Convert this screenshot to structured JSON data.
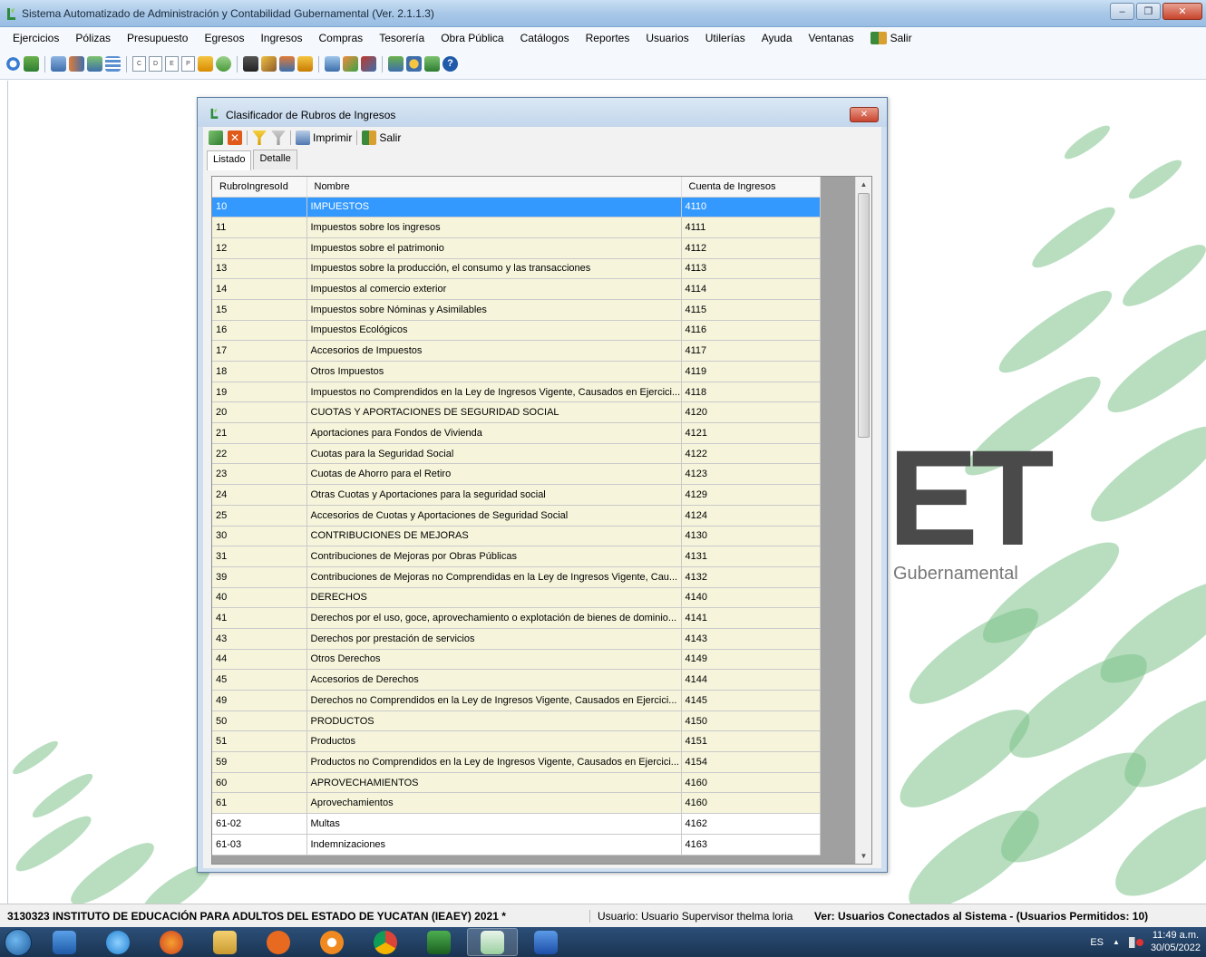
{
  "window": {
    "title": "Sistema Automatizado de Administración y Contabilidad Gubernamental  (Ver. 2.1.1.3)",
    "minimize_glyph": "‒",
    "restore_glyph": "❐",
    "close_glyph": "✕"
  },
  "menu": [
    "Ejercicios",
    "Pólizas",
    "Presupuesto",
    "Egresos",
    "Ingresos",
    "Compras",
    "Tesorería",
    "Obra Pública",
    "Catálogos",
    "Reportes",
    "Usuarios",
    "Utilerías",
    "Ayuda",
    "Ventanas",
    "Salir"
  ],
  "toolbar_icons": [
    "refresh-icon",
    "report-icon",
    "print-icon",
    "transfer-icon",
    "ledger-icon",
    "grid-icon",
    "doc-c-icon",
    "doc-d-icon",
    "doc-e-icon",
    "doc-p-icon",
    "budget-icon",
    "money-icon",
    "archive-icon",
    "edit-icon",
    "users-icon",
    "box-icon",
    "calc-icon",
    "tools-icon",
    "settings-icon",
    "tree-icon",
    "security-icon",
    "save-icon",
    "help-icon"
  ],
  "toolbar_doc_letters": [
    "C",
    "D",
    "E",
    "P"
  ],
  "background_logo": {
    "letters": "ET",
    "subtitle": "Gubernamental"
  },
  "dialog": {
    "title": "Clasificador de Rubros de Ingresos",
    "close_glyph": "✕",
    "tools": {
      "print_label": "Imprimir",
      "exit_label": "Salir"
    },
    "tabs": [
      "Listado",
      "Detalle"
    ],
    "columns": [
      "RubroIngresoId",
      "Nombre",
      "Cuenta de Ingresos"
    ],
    "rows": [
      [
        "10",
        "IMPUESTOS",
        "4110"
      ],
      [
        "11",
        "Impuestos sobre los ingresos",
        "4111"
      ],
      [
        "12",
        "Impuestos sobre el patrimonio",
        "4112"
      ],
      [
        "13",
        "Impuestos sobre la producción, el consumo y las transacciones",
        "4113"
      ],
      [
        "14",
        "Impuestos al comercio exterior",
        "4114"
      ],
      [
        "15",
        "Impuestos sobre Nóminas y Asimilables",
        "4115"
      ],
      [
        "16",
        "Impuestos Ecológicos",
        "4116"
      ],
      [
        "17",
        "Accesorios de Impuestos",
        "4117"
      ],
      [
        "18",
        "Otros Impuestos",
        "4119"
      ],
      [
        "19",
        "Impuestos no Comprendidos en la Ley de Ingresos Vigente, Causados en Ejercici...",
        "4118"
      ],
      [
        "20",
        "CUOTAS Y APORTACIONES DE SEGURIDAD SOCIAL",
        "4120"
      ],
      [
        "21",
        "Aportaciones para Fondos de Vivienda",
        "4121"
      ],
      [
        "22",
        "Cuotas para la Seguridad Social",
        "4122"
      ],
      [
        "23",
        "Cuotas de Ahorro para el Retiro",
        "4123"
      ],
      [
        "24",
        "Otras Cuotas y Aportaciones para la seguridad social",
        "4129"
      ],
      [
        "25",
        "Accesorios de Cuotas y Aportaciones de Seguridad Social",
        "4124"
      ],
      [
        "30",
        "CONTRIBUCIONES DE MEJORAS",
        "4130"
      ],
      [
        "31",
        "Contribuciones de Mejoras por Obras Públicas",
        "4131"
      ],
      [
        "39",
        "Contribuciones de Mejoras no Comprendidas en la Ley de Ingresos Vigente, Cau...",
        "4132"
      ],
      [
        "40",
        "DERECHOS",
        "4140"
      ],
      [
        "41",
        "Derechos por el uso, goce, aprovechamiento o explotación de bienes de dominio...",
        "4141"
      ],
      [
        "43",
        "Derechos por prestación de servicios",
        "4143"
      ],
      [
        "44",
        "Otros Derechos",
        "4149"
      ],
      [
        "45",
        "Accesorios de Derechos",
        "4144"
      ],
      [
        "49",
        "Derechos no Comprendidos en la Ley de Ingresos Vigente, Causados en Ejercici...",
        "4145"
      ],
      [
        "50",
        "PRODUCTOS",
        "4150"
      ],
      [
        "51",
        "Productos",
        "4151"
      ],
      [
        "59",
        "Productos no Comprendidos en la Ley de Ingresos Vigente, Causados en Ejercici...",
        "4154"
      ],
      [
        "60",
        "APROVECHAMIENTOS",
        "4160"
      ],
      [
        "61",
        "Aprovechamientos",
        "4160"
      ],
      [
        "61-02",
        "Multas",
        "4162"
      ],
      [
        "61-03",
        "Indemnizaciones",
        "4163"
      ]
    ],
    "selected_row": 0,
    "white_rows_from": 30
  },
  "status": {
    "entity": "3130323 INSTITUTO DE EDUCACIÓN PARA ADULTOS DEL ESTADO DE YUCATAN (IEAEY)  2021  *",
    "user": "Usuario: Usuario Supervisor thelma loria",
    "connected": "Ver: Usuarios Conectados al Sistema - (Usuarios Permitidos: 10)"
  },
  "taskbar": {
    "apps": [
      "media-player-icon",
      "internet-explorer-icon",
      "firefox-icon",
      "file-explorer-icon",
      "app-orange-icon",
      "app-blue-icon",
      "chrome-icon",
      "excel-icon",
      "saacg-icon",
      "word-icon"
    ],
    "language": "ES",
    "tray_up_glyph": "▲",
    "time": "11:49 a.m.",
    "date": "30/05/2022"
  },
  "colors": {
    "selected_row": "#3399ff",
    "row_bg": "#f6f5dc",
    "brand_green": "#3a9a4a"
  }
}
